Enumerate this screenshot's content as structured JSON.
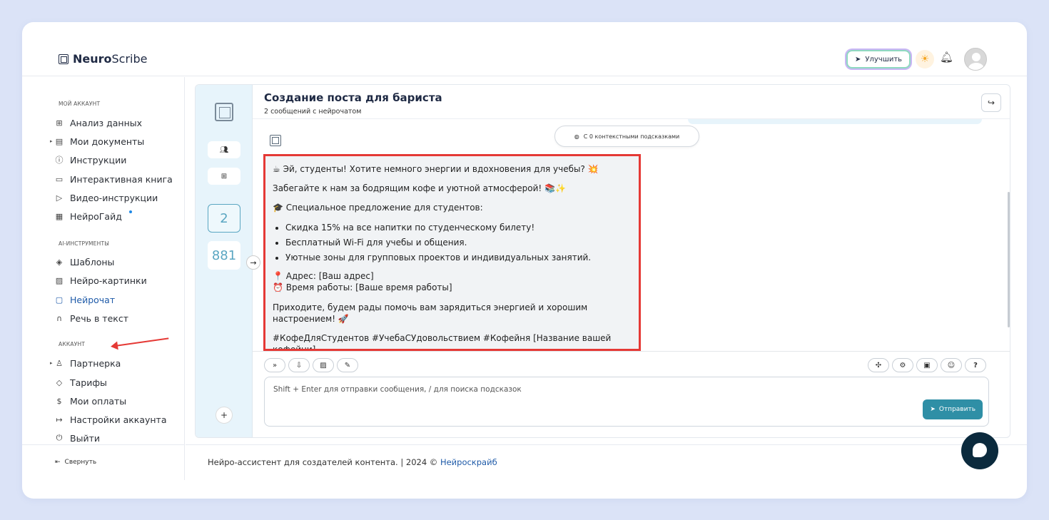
{
  "header": {
    "logo_bold": "Neuro",
    "logo_light": "Scribe",
    "upgrade_label": "Улучшить"
  },
  "sidebar": {
    "sections": [
      {
        "title": "МОЙ АККАУНТ"
      },
      {
        "title": "AI-ИНСТРУМЕНТЫ"
      },
      {
        "title": "АККАУНТ"
      }
    ],
    "items": [
      {
        "label": "Анализ данных",
        "icon": "grid-icon"
      },
      {
        "label": "Мои документы",
        "icon": "document-icon"
      },
      {
        "label": "Инструкции",
        "icon": "help-icon"
      },
      {
        "label": "Интерактивная книга",
        "icon": "book-icon"
      },
      {
        "label": "Видео-инструкции",
        "icon": "video-icon"
      },
      {
        "label": "НейроГайд",
        "icon": "guide-icon"
      },
      {
        "label": "Шаблоны",
        "icon": "layers-icon"
      },
      {
        "label": "Нейро-картинки",
        "icon": "image-icon"
      },
      {
        "label": "Нейрочат",
        "icon": "chat-icon"
      },
      {
        "label": "Речь в текст",
        "icon": "headphones-icon"
      },
      {
        "label": "Партнерка",
        "icon": "users-icon"
      },
      {
        "label": "Тарифы",
        "icon": "tag-icon"
      },
      {
        "label": "Мои оплаты",
        "icon": "dollar-icon"
      },
      {
        "label": "Настройки аккаунта",
        "icon": "logout-arrow-icon"
      },
      {
        "label": "Выйти",
        "icon": "power-icon"
      }
    ],
    "collapse_label": "Свернуть"
  },
  "rail": {
    "messages_count": "2",
    "tokens_count": "881"
  },
  "chat": {
    "title": "Создание поста для бариста",
    "subtitle": "2 сообщений с нейрочатом",
    "hints_label": "С 0 контекстными подсказками",
    "message": {
      "line1": "☕ Эй, студенты! Хотите немного энергии и вдохновения для учебы? 💥",
      "line2": "Забегайте к нам за бодрящим кофе и уютной атмосферой! 📚✨",
      "line3": "🎓 Специальное предложение для студентов:",
      "bullets": [
        "Скидка 15% на все напитки по студенческому билету!",
        "Бесплатный Wi-Fi для учебы и общения.",
        "Уютные зоны для групповых проектов и индивидуальных занятий."
      ],
      "address": "📍 Адрес: [Ваш адрес]",
      "hours": "⏰ Время работы: [Ваше время работы]",
      "cta": "Приходите, будем рады помочь вам зарядиться энергией и хорошим настроением! 🚀",
      "tags": "#КофеДляСтудентов #УчебаСУдовольствием #Кофейня [Название вашей кофейни]"
    },
    "input_placeholder": "Shift + Enter для отправки сообщения, / для поиска подсказок",
    "send_label": "Отправить"
  },
  "footer": {
    "text": "Нейро-ассистент для создателей контента.  | 2024 © ",
    "link": "Нейроскрайб"
  },
  "colors": {
    "accent": "#2f8fa6",
    "highlight_border": "#e53935",
    "active_nav": "#1e5aa8"
  }
}
